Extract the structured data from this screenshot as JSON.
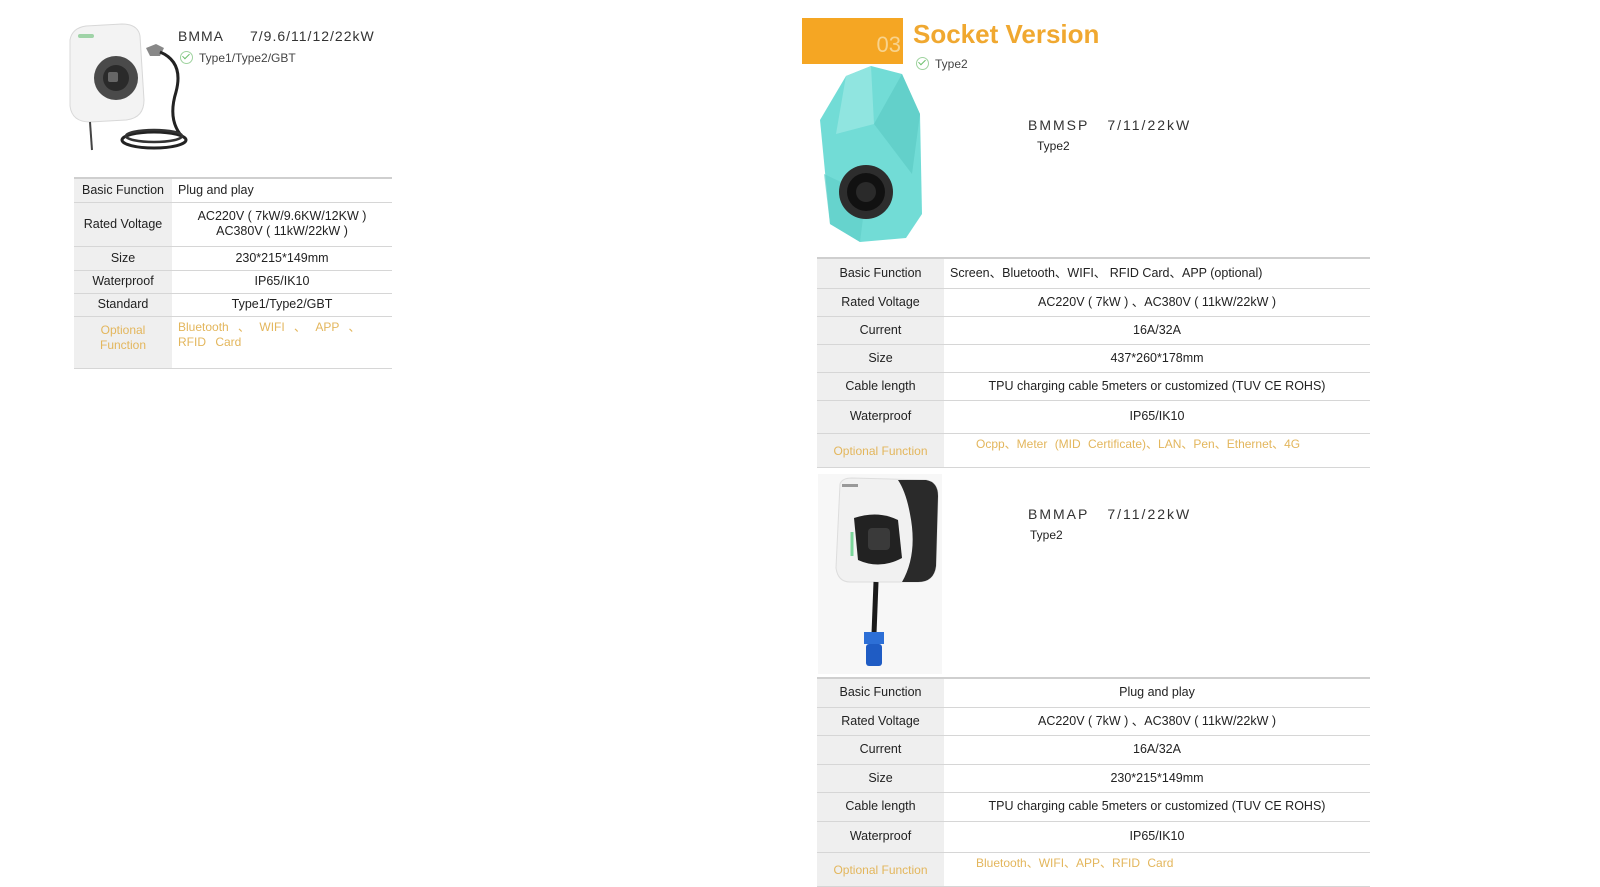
{
  "left_product": {
    "model": "BMMA",
    "power": "7/9.6/11/12/22kW",
    "connectors": "Type1/Type2/GBT",
    "specs": [
      {
        "key": "Basic Function",
        "value": "Plug and play"
      },
      {
        "key": "Rated Voltage",
        "value_lines": [
          "AC220V ( 7kW/9.6KW/12KW )",
          "AC380V ( 11kW/22kW )"
        ]
      },
      {
        "key": "Size",
        "value": "230*215*149mm"
      },
      {
        "key": "Waterproof",
        "value": "IP65/IK10"
      },
      {
        "key": "Standard",
        "value": "Type1/Type2/GBT"
      },
      {
        "key": "Optional Function",
        "value": "Bluetooth 、 WIFI 、 APP 、 RFID Card"
      }
    ]
  },
  "section": {
    "number": "03",
    "title": "Socket Version",
    "connector": "Type2"
  },
  "product_bmmsp": {
    "model": "BMMSP",
    "power": "7/11/22kW",
    "connector": "Type2",
    "specs": [
      {
        "key": "Basic Function",
        "value": "Screen、Bluetooth、WIFI、 RFID Card、APP (optional)"
      },
      {
        "key": "Rated Voltage",
        "value": "AC220V ( 7kW ) 、AC380V ( 11kW/22kW )"
      },
      {
        "key": "Current",
        "value": "16A/32A"
      },
      {
        "key": "Size",
        "value": "437*260*178mm"
      },
      {
        "key": "Cable length",
        "value": "TPU charging cable 5meters or customized (TUV CE ROHS)"
      },
      {
        "key": "Waterproof",
        "value": "IP65/IK10"
      },
      {
        "key": "Optional Function",
        "value": "Ocpp、Meter (MID Certificate)、LAN、Pen、Ethernet、4G"
      }
    ]
  },
  "product_bmmap": {
    "model": "BMMAP",
    "power": "7/11/22kW",
    "connector": "Type2",
    "specs": [
      {
        "key": "Basic Function",
        "value": "Plug and play"
      },
      {
        "key": "Rated Voltage",
        "value": "AC220V ( 7kW ) 、AC380V ( 11kW/22kW )"
      },
      {
        "key": "Current",
        "value": "16A/32A"
      },
      {
        "key": "Size",
        "value": "230*215*149mm"
      },
      {
        "key": "Cable length",
        "value": "TPU charging cable 5meters or customized (TUV CE ROHS)"
      },
      {
        "key": "Waterproof",
        "value": "IP65/IK10"
      },
      {
        "key": "Optional Function",
        "value": "Bluetooth、WIFI、APP、RFID Card"
      }
    ]
  },
  "colors": {
    "accent_orange": "#f5a623",
    "optional_text": "#e3b65c",
    "key_cell_bg": "#efefef",
    "teal_housing": "#72dcd6"
  }
}
